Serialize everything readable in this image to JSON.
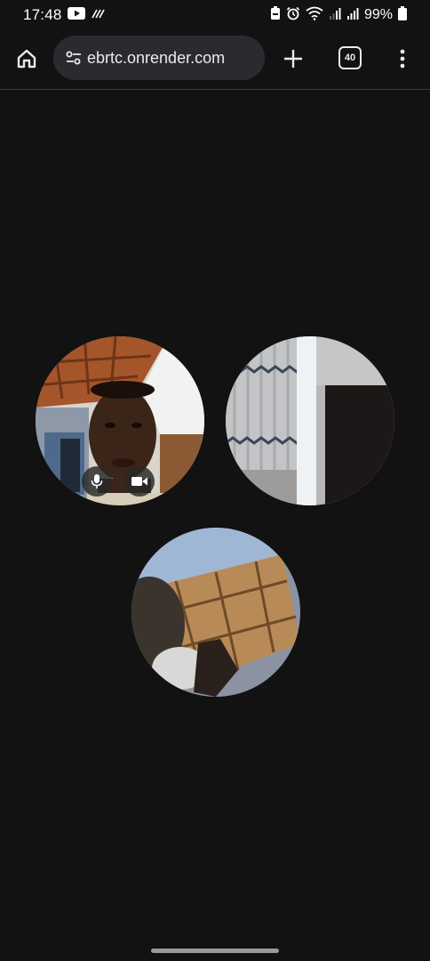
{
  "status_bar": {
    "time": "17:48",
    "battery_percent": "99%",
    "icons": [
      "youtube-icon",
      "data-saver-icon",
      "battery-saver-icon",
      "alarm-icon",
      "wifi-icon",
      "signal-icon",
      "signal-icon",
      "battery-icon"
    ]
  },
  "browser": {
    "url": "ebrtc.onrender.com",
    "tab_count": "40",
    "icons": {
      "home": "home-icon",
      "site_settings": "tune-icon",
      "new_tab": "plus-icon",
      "menu": "more-vert-icon"
    }
  },
  "video_grid": {
    "participants": [
      {
        "id": "local",
        "controls": [
          "mic-icon",
          "videocam-icon"
        ]
      },
      {
        "id": "remote-1"
      },
      {
        "id": "remote-2"
      }
    ]
  },
  "colors": {
    "background": "#121212",
    "address_bar": "#2a2b2f",
    "icon": "#e8eaed"
  }
}
